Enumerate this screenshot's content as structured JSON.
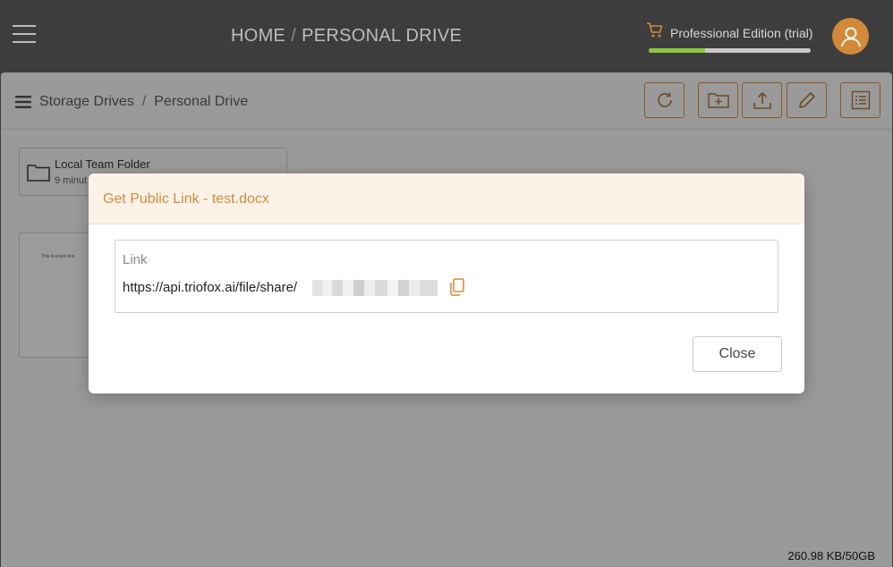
{
  "topbar": {
    "breadcrumb": [
      "HOME",
      "PERSONAL DRIVE"
    ],
    "separator": "/",
    "edition_label": "Professional Edition (trial)",
    "trial_progress": 0.35
  },
  "toolbar": {
    "breadcrumb": [
      "Storage Drives",
      "Personal Drive"
    ],
    "separator": "/"
  },
  "files": {
    "folder": {
      "name": "Local Team Folder",
      "meta": "9 minut"
    },
    "document_thumb_text": "This is a test doc"
  },
  "storage_usage": "260.98 KB/50GB",
  "modal": {
    "title": "Get Public Link - test.docx",
    "link_label": "Link",
    "link_url": "https://api.triofox.ai/file/share/",
    "close_label": "Close"
  },
  "colors": {
    "accent": "#d28a3a",
    "progress": "#8cc63f",
    "modal_header_bg": "#fcf2e8"
  }
}
